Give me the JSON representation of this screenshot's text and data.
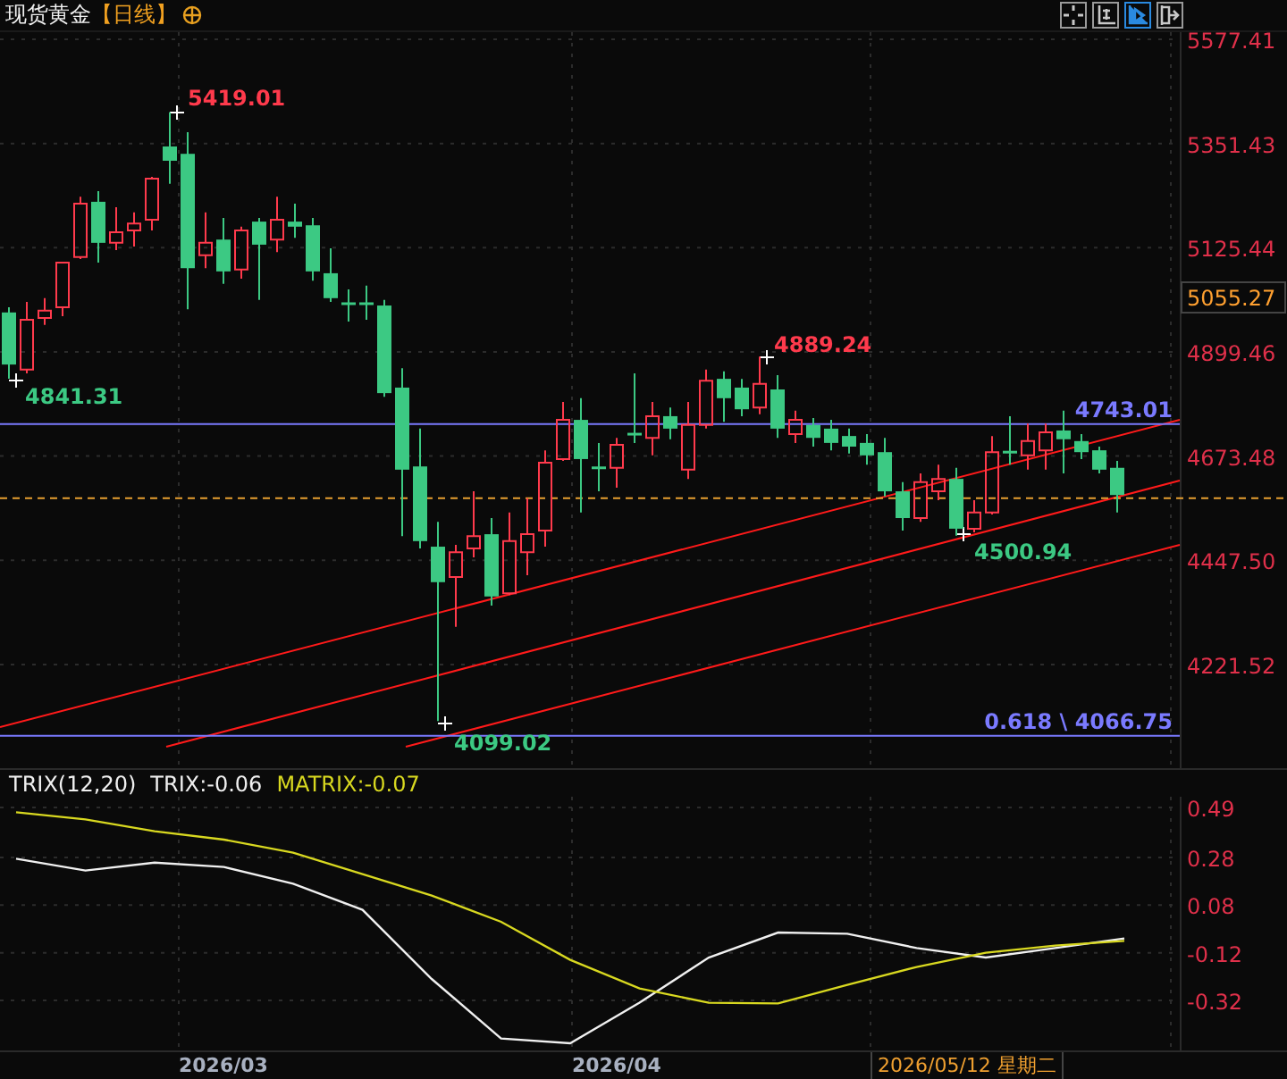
{
  "header": {
    "title": "现货黄金",
    "period": "【日线】",
    "toolbar_buttons": [
      {
        "selected": false
      },
      {
        "selected": false
      },
      {
        "selected": true
      },
      {
        "selected": false
      }
    ]
  },
  "price_panel": {
    "crosshair_price": "5055.27",
    "annotations": [
      {
        "text": "5419.01",
        "kind": "high"
      },
      {
        "text": "4841.31",
        "kind": "low"
      },
      {
        "text": "4889.24",
        "kind": "high"
      },
      {
        "text": "4500.94",
        "kind": "low"
      },
      {
        "text": "4099.02",
        "kind": "low"
      }
    ],
    "chart_data": {
      "type": "candlestick",
      "grid": true,
      "ylim": [
        3996.6,
        5592.9
      ],
      "yticks": [
        5577.41,
        5351.43,
        5125.44,
        4899.46,
        4673.48,
        {
          "value": 4447.5,
          "label": "4447.50"
        },
        4221.52
      ],
      "ref_lines": [
        {
          "axis": "y",
          "value": 4743.01,
          "label": "4743.01",
          "color": "#7a7aff"
        },
        {
          "axis": "y",
          "value": 4066.75,
          "label": "0.618 \\ 4066.75",
          "color": "#7a7aff"
        },
        {
          "axis": "y",
          "value": 4582,
          "color": "#e8a030"
        }
      ],
      "categories": [
        null,
        null,
        null,
        null,
        null,
        null,
        null,
        null,
        null,
        null,
        null,
        null,
        null,
        null,
        null,
        null,
        null,
        null,
        null,
        null,
        null,
        null,
        null,
        null,
        null,
        null,
        null,
        null,
        null,
        null,
        null,
        null,
        null,
        null,
        null,
        null,
        null,
        null,
        null,
        null,
        null,
        null,
        null,
        null,
        null,
        null,
        null,
        null,
        null,
        null,
        null,
        null,
        null,
        null,
        null,
        null,
        null,
        null,
        null,
        null,
        null,
        null,
        null,
        null,
        null,
        null
      ],
      "ohlc": [
        [
          4985,
          4996,
          4841.31,
          4872
        ],
        [
          4861,
          5008,
          4853,
          4969
        ],
        [
          4973,
          5016,
          4958,
          4989
        ],
        [
          4996,
          5095,
          4977,
          5093
        ],
        [
          5105,
          5236,
          5101,
          5221
        ],
        [
          5225,
          5248,
          5093,
          5136
        ],
        [
          5136,
          5213,
          5120,
          5159
        ],
        [
          5163,
          5202,
          5128,
          5178
        ],
        [
          5186,
          5279,
          5163,
          5275
        ],
        [
          5345,
          5419.01,
          5264,
          5314
        ],
        [
          5329,
          5376,
          4992,
          5081
        ],
        [
          5109,
          5202,
          5081,
          5136
        ],
        [
          5143,
          5190,
          5047,
          5074
        ],
        [
          5078,
          5171,
          5058,
          5163
        ],
        [
          5182,
          5190,
          5012,
          5132
        ],
        [
          5143,
          5236,
          5116,
          5186
        ],
        [
          5182,
          5221,
          5147,
          5171
        ],
        [
          5174,
          5190,
          5054,
          5074
        ],
        [
          5070,
          5124,
          5008,
          5016
        ],
        [
          5004,
          5035,
          4965,
          5004
        ],
        [
          5004,
          5043,
          4969,
          5004
        ],
        [
          5000,
          5012,
          4802,
          4810
        ],
        [
          4822,
          4864,
          4500,
          4644
        ],
        [
          4651,
          4733,
          4473,
          4489
        ],
        [
          4477,
          4531,
          4099.02,
          4400
        ],
        [
          4411,
          4481,
          4303,
          4465
        ],
        [
          4473,
          4597,
          4454,
          4500
        ],
        [
          4504,
          4539,
          4349,
          4369
        ],
        [
          4376,
          4551,
          4372,
          4489
        ],
        [
          4465,
          4582,
          4415,
          4504
        ],
        [
          4512,
          4686,
          4477,
          4659
        ],
        [
          4667,
          4791,
          4663,
          4752
        ],
        [
          4752,
          4799,
          4551,
          4667
        ],
        [
          4648,
          4702,
          4597,
          4648
        ],
        [
          4648,
          4713,
          4605,
          4698
        ],
        [
          4721,
          4853,
          4702,
          4721
        ],
        [
          4713,
          4791,
          4675,
          4760
        ],
        [
          4760,
          4779,
          4710,
          4733
        ],
        [
          4644,
          4791,
          4624,
          4741
        ],
        [
          4741,
          4861,
          4733,
          4837
        ],
        [
          4841,
          4857,
          4748,
          4799
        ],
        [
          4822,
          4841,
          4760,
          4775
        ],
        [
          4779,
          4889.24,
          4764,
          4830
        ],
        [
          4818,
          4849,
          4713,
          4733
        ],
        [
          4721,
          4772,
          4702,
          4752
        ],
        [
          4741,
          4756,
          4694,
          4713
        ],
        [
          4733,
          4752,
          4686,
          4702
        ],
        [
          4717,
          4733,
          4679,
          4694
        ],
        [
          4702,
          4721,
          4655,
          4675
        ],
        [
          4682,
          4713,
          4586,
          4597
        ],
        [
          4597,
          4617,
          4512,
          4539
        ],
        [
          4539,
          4636,
          4531,
          4617
        ],
        [
          4597,
          4655,
          4578,
          4624
        ],
        [
          4624,
          4648,
          4500.94,
          4516
        ],
        [
          4516,
          4578,
          4508,
          4551
        ],
        [
          4551,
          4717,
          4547,
          4682
        ],
        [
          4682,
          4760,
          4655,
          4682
        ],
        [
          4675,
          4744,
          4644,
          4706
        ],
        [
          4686,
          4744,
          4644,
          4725
        ],
        [
          4729,
          4772,
          4636,
          4710
        ],
        [
          4706,
          4721,
          4667,
          4682
        ],
        [
          4686,
          4694,
          4636,
          4644
        ],
        [
          4648,
          4663,
          4551,
          4589
        ],
        null,
        null,
        null
      ]
    }
  },
  "indicator": {
    "name": "TRIX(12,20)",
    "readouts": [
      {
        "value": ":-0.06"
      },
      {
        "value": ":-0.07"
      }
    ],
    "chart_data": {
      "type": "line",
      "grid": true,
      "ylim": [
        -0.53,
        0.535
      ],
      "categories": [
        null,
        null,
        null,
        null,
        null,
        null,
        null,
        null,
        null,
        null,
        null,
        null,
        null,
        null,
        null,
        null,
        null
      ],
      "series": [
        {
          "name": "TRIX",
          "color": "#f0f0f0",
          "values": [
            0.275,
            0.225,
            0.258,
            0.24,
            0.17,
            0.06,
            -0.23,
            -0.48,
            -0.5,
            -0.33,
            -0.14,
            -0.035,
            -0.04,
            -0.1,
            -0.14,
            -0.1,
            -0.06
          ]
        },
        {
          "name": "MATRIX",
          "color": "#d8d820",
          "values": [
            0.47,
            0.44,
            0.39,
            0.355,
            0.3,
            0.21,
            0.12,
            0.01,
            -0.15,
            -0.27,
            -0.33,
            -0.333,
            -0.255,
            -0.18,
            -0.12,
            -0.09,
            -0.07
          ]
        }
      ],
      "yticks": [
        0.49,
        0.28,
        0.08,
        -0.12,
        -0.32
      ]
    }
  },
  "date_axis": {
    "labels": [
      "2026/03",
      "2026/04"
    ],
    "crosshair_date": "2026/05/12 星期二"
  }
}
